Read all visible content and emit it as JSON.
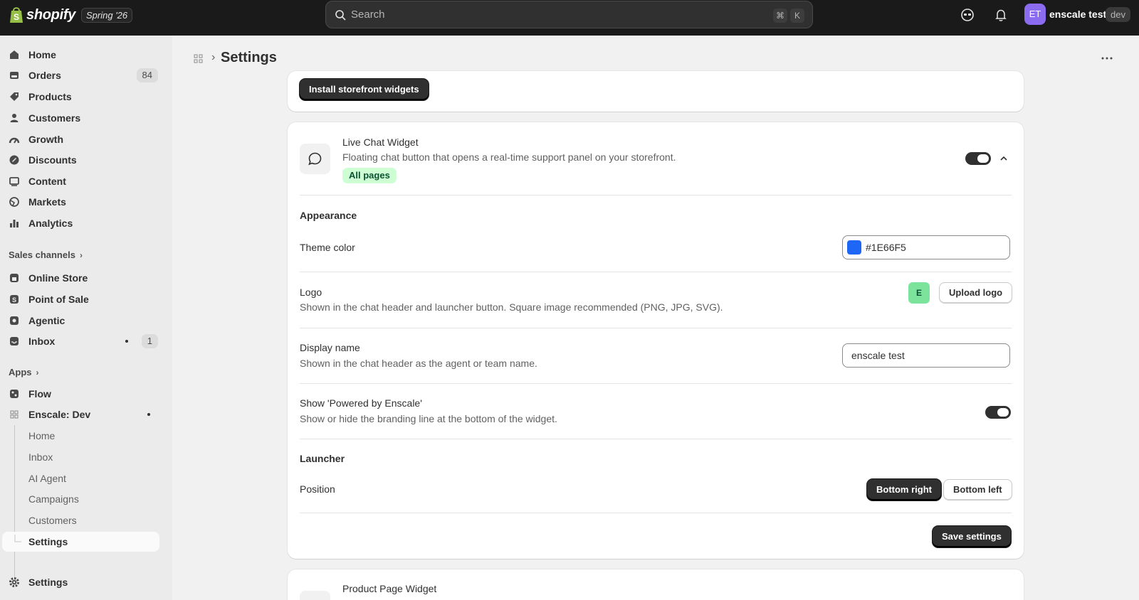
{
  "topbar": {
    "brand": "shopify",
    "release_badge": "Spring '26",
    "search_placeholder": "Search",
    "shortcut_keys": [
      "⌘",
      "K"
    ],
    "avatar_initials": "ET",
    "store_name": "enscale test",
    "env_badge": "dev"
  },
  "sidebar": {
    "main_items": [
      {
        "label": "Home",
        "icon": "home-icon"
      },
      {
        "label": "Orders",
        "icon": "orders-icon",
        "count": "84"
      },
      {
        "label": "Products",
        "icon": "tag-icon"
      },
      {
        "label": "Customers",
        "icon": "person-icon"
      },
      {
        "label": "Growth",
        "icon": "growth-icon"
      },
      {
        "label": "Discounts",
        "icon": "discount-icon"
      },
      {
        "label": "Content",
        "icon": "content-icon"
      },
      {
        "label": "Markets",
        "icon": "globe-icon"
      },
      {
        "label": "Analytics",
        "icon": "bar-chart-icon"
      }
    ],
    "sales_channels_label": "Sales channels",
    "sales_channels": [
      {
        "label": "Online Store",
        "icon": "store-icon"
      },
      {
        "label": "Point of Sale",
        "icon": "pos-icon"
      },
      {
        "label": "Agentic",
        "icon": "agentic-icon"
      },
      {
        "label": "Inbox",
        "icon": "inbox-icon",
        "count": "1"
      }
    ],
    "apps_label": "Apps",
    "apps": [
      {
        "label": "Flow",
        "icon": "flow-icon"
      },
      {
        "label": "Enscale: Dev",
        "icon": "app-grid-icon"
      }
    ],
    "app_subitems": [
      "Home",
      "Inbox",
      "AI Agent",
      "Campaigns",
      "Customers",
      "Settings"
    ],
    "settings_label": "Settings"
  },
  "header": {
    "title": "Settings"
  },
  "top_card": {
    "install_button": "Install storefront widgets"
  },
  "live_chat": {
    "title": "Live Chat Widget",
    "description": "Floating chat button that opens a real-time support panel on your storefront.",
    "scope_badge": "All pages",
    "enabled": true,
    "appearance_heading": "Appearance",
    "theme_color_label": "Theme color",
    "theme_color_value": "#1E66F5",
    "theme_color_hex": "#1E66F5",
    "logo_label": "Logo",
    "logo_help": "Shown in the chat header and launcher button. Square image recommended (PNG, JPG, SVG).",
    "logo_initial": "E",
    "upload_logo_button": "Upload logo",
    "display_name_label": "Display name",
    "display_name_help": "Shown in the chat header as the agent or team name.",
    "display_name_value": "enscale test",
    "powered_by_label": "Show 'Powered by Enscale'",
    "powered_by_help": "Show or hide the branding line at the bottom of the widget.",
    "powered_by_enabled": true,
    "launcher_heading": "Launcher",
    "position_label": "Position",
    "position_options": [
      "Bottom right",
      "Bottom left"
    ],
    "position_selected": "Bottom right",
    "save_button": "Save settings"
  },
  "product_page": {
    "title": "Product Page Widget"
  }
}
